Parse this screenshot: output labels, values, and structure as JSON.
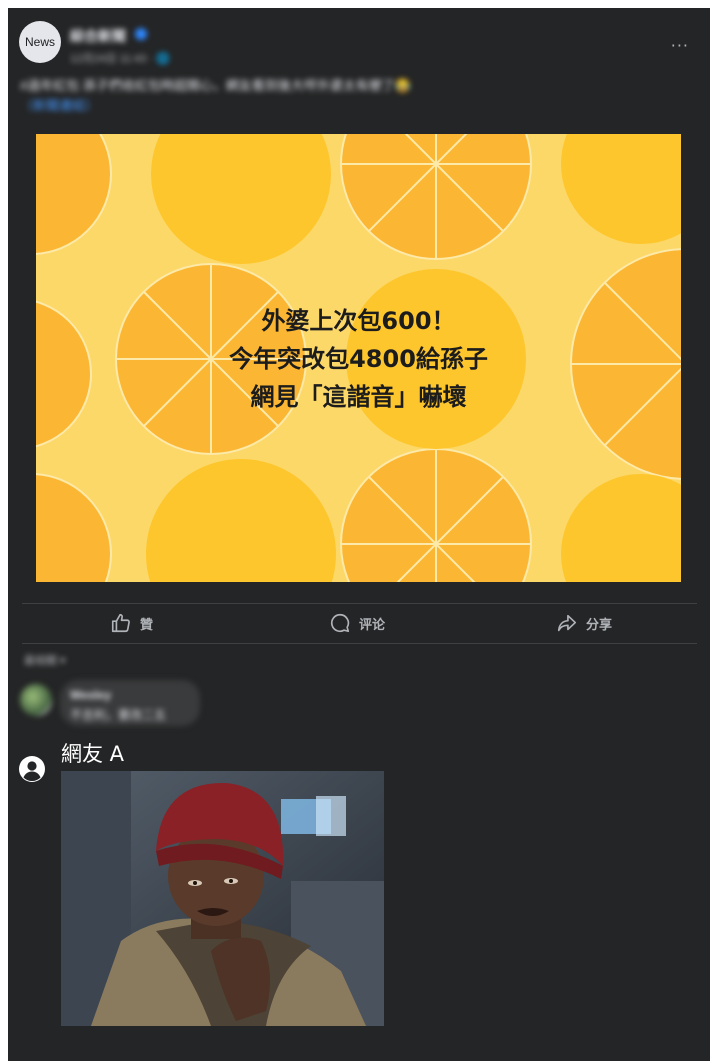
{
  "post": {
    "avatar_text": "News",
    "page_name": "綜合新聞",
    "timestamp": "12月24日 11:43 · 🌐",
    "caption_text": "#過年紅包 孫子們收紅包時超開心，網友看到後大呼外婆太有梗了😂",
    "caption_link": "（新聞連結）"
  },
  "image": {
    "headline_lines": [
      "外婆上次包600！",
      "今年突改包4800給孫子",
      "網見「這諧音」嚇壞"
    ],
    "bg_color": "#fcd868",
    "orange_color": "#fbb733"
  },
  "actions": {
    "like": "贊",
    "comment": "评论",
    "share": "分享"
  },
  "comments": {
    "sort_label": "最相關 ▾",
    "first": {
      "name": "Wesley",
      "text": "不吉利，要改二五"
    },
    "netizen": {
      "name": "網友 A"
    }
  }
}
